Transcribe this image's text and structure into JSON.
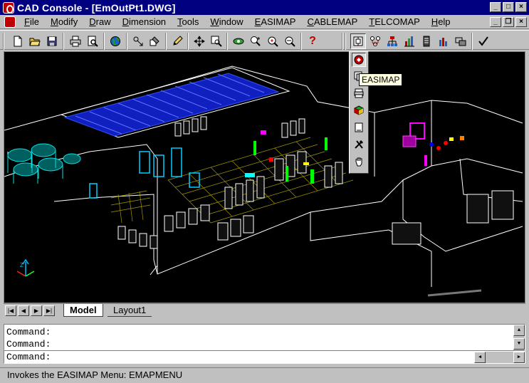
{
  "window": {
    "title": "CAD Console - [EmOutPt1.DWG]"
  },
  "menubar": {
    "items": [
      {
        "label": "File",
        "u": "F",
        "rest": "ile"
      },
      {
        "label": "Modify",
        "u": "M",
        "rest": "odify"
      },
      {
        "label": "Draw",
        "u": "D",
        "rest": "raw"
      },
      {
        "label": "Dimension",
        "u": "D",
        "rest": "imension"
      },
      {
        "label": "Tools",
        "u": "T",
        "rest": "ools"
      },
      {
        "label": "Window",
        "u": "W",
        "rest": "indow"
      },
      {
        "label": "EASIMAP",
        "u": "E",
        "rest": "ASIMAP"
      },
      {
        "label": "CABLEMAP",
        "u": "C",
        "rest": "ABLEMAP"
      },
      {
        "label": "TELCOMAP",
        "u": "T",
        "rest": "ELCOMAP"
      },
      {
        "label": "Help",
        "u": "H",
        "rest": "elp"
      }
    ]
  },
  "tooltip": {
    "text": "EASIMAP"
  },
  "tabs": {
    "model": "Model",
    "layout1": "Layout1"
  },
  "command": {
    "history": [
      "Command:",
      "Command:"
    ],
    "prompt": "Command:"
  },
  "status": {
    "text": "Invokes the EASIMAP Menu:  EMAPMENU"
  },
  "colors": {
    "title_bar": "#000080",
    "canvas": "#000000",
    "chrome": "#c0c0c0",
    "tooltip_bg": "#ffffe1"
  },
  "icons": [
    "app-icon",
    "new-icon",
    "open-icon",
    "save-icon",
    "print-icon",
    "print-preview-icon",
    "globe-icon",
    "snap-icon",
    "match-properties-icon",
    "pencil-icon",
    "pan-icon",
    "zoom-window-icon",
    "orbit-icon",
    "zoom-realtime-icon",
    "zoom-previous-icon",
    "zoom-extents-icon",
    "help-icon",
    "easimap-icon",
    "checkmark-icon"
  ]
}
